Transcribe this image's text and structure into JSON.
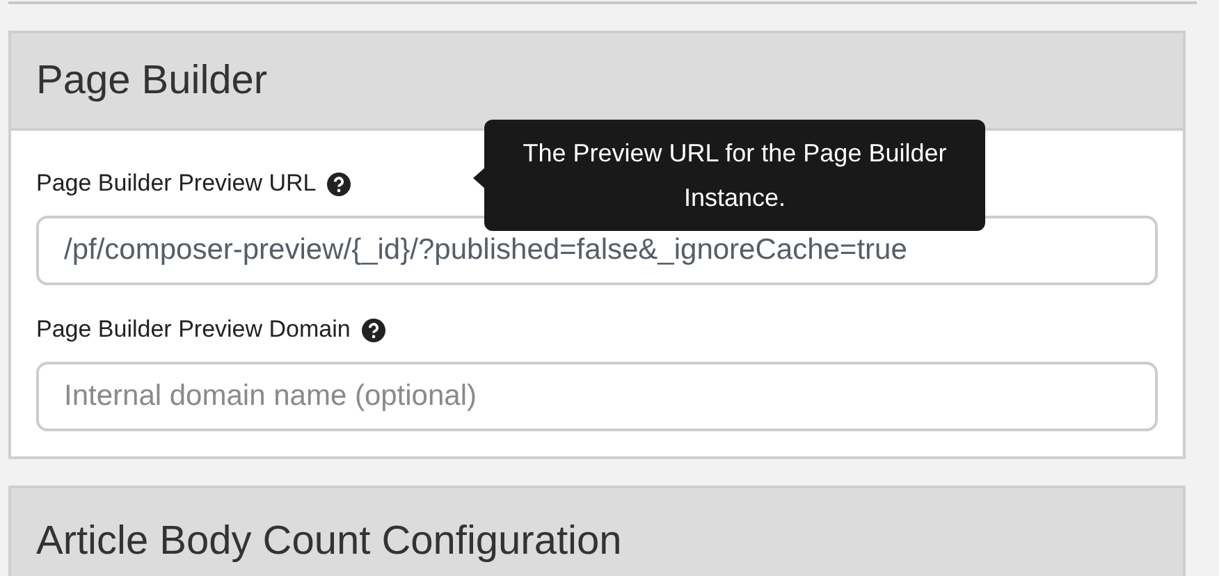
{
  "panels": [
    {
      "title": "Page Builder",
      "fields": [
        {
          "label": "Page Builder Preview URL",
          "value": "/pf/composer-preview/{_id}/?published=false&_ignoreCache=true",
          "tooltip": "The Preview URL for the Page Builder Instance."
        },
        {
          "label": "Page Builder Preview Domain",
          "placeholder": "Internal domain name (optional)"
        }
      ]
    },
    {
      "title": "Article Body Count Configuration"
    }
  ]
}
